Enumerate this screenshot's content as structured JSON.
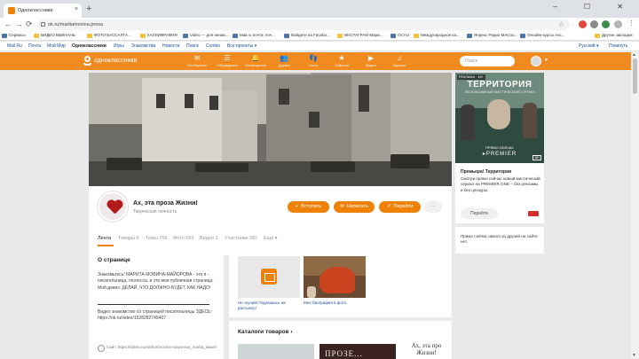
{
  "browser": {
    "tab_title": "Одноклассники",
    "tab_close": "×",
    "new_tab": "+",
    "window_buttons": "– ☐ ✕",
    "nav_back": "←",
    "nav_forward": "→",
    "nav_reload": "⟳",
    "url": "ok.ru/maritamovina.prosa",
    "star": "☆"
  },
  "bookmarks": [
    {
      "label": "Сервисы"
    },
    {
      "label": "ВИДЕО ВВИНАНЬ"
    },
    {
      "label": "ФОТО БАССАЛТА..."
    },
    {
      "label": "КАЛЛИФРАФИЯ"
    },
    {
      "label": "Video — для ненав..."
    },
    {
      "label": "Mail.ru почта: поч..."
    },
    {
      "label": "Войдите на Facebo..."
    },
    {
      "label": "ИНСТАГРАМ Мари..."
    },
    {
      "label": "OCAU"
    },
    {
      "label": "Международное ка..."
    },
    {
      "label": "Яндекс Радио МАСоо..."
    },
    {
      "label": "Онлайн-курсы Анс..."
    },
    {
      "label": "Другие закладки"
    }
  ],
  "mailru": {
    "items": [
      "Mail.Ru",
      "Почта",
      "Мой Мир",
      "Одноклассники",
      "Игры",
      "Знакомства",
      "Новости",
      "Поиск",
      "Combo",
      "Все проекты ▾"
    ],
    "language": "Русский ▾",
    "logout": "Покинуть"
  },
  "ok": {
    "brand": "одноклассники",
    "nav": [
      {
        "icon": "✉",
        "label": "Сообщения"
      },
      {
        "icon": "☰",
        "label": "Обсуждения"
      },
      {
        "icon": "🔔",
        "label": "Оповещения"
      },
      {
        "icon": "👥",
        "label": "Друзья"
      },
      {
        "icon": "👣",
        "label": "Гости"
      },
      {
        "icon": "★",
        "label": "События"
      },
      {
        "icon": "▶",
        "label": "Видео"
      },
      {
        "icon": "♫",
        "label": "Музыка"
      }
    ],
    "search_placeholder": "Поиск"
  },
  "profile": {
    "name": "Ах, эта проза Жизни!",
    "type": "Творческая личность",
    "join_button": "Вступить",
    "write_button": "Написать",
    "goto_button": "Перейти",
    "more_button": "···",
    "tabs": [
      "Лента",
      "Товары 6",
      "Темы 766",
      "Фото 693",
      "Видео 1",
      "Участники 382",
      "Ещё ▾"
    ]
  },
  "about": {
    "title": "О странице",
    "text1": "Знакомьтесь! МАРИТА МОВИНА-МАЙОРОВА - это я - писательница, поэтесса, и это моя публичная страница. Мой девиз: ДЕЛАЙ, ЧТО ДОЛЖНО-БУДЕТ, КАК НАДО!",
    "text2": "Видео знакомство со страницей писательницы ЗДЕСЬ: https://ok.ru/video/1528282745407",
    "site": "Сайт: https://ridero.ru/author/movina-mayorova_marita_iaaue/"
  },
  "media": {
    "items": [
      {
        "caption": "Не скучай! Подпишись на рассылку!"
      },
      {
        "caption": "Моя биография в фото"
      }
    ]
  },
  "catalog": {
    "title": "Каталоги товаров",
    "arrow": "›",
    "item2_text": "ПРОЗЕ...",
    "item3_text": "Ах, эта про Жизни!"
  },
  "ad": {
    "label": "РЕКЛАМА · 18+",
    "title": "ТЕРРИТОРИЯ",
    "subtitle": "ЭКСКЛЮЗИВНЫЙ МИСТИЧЕСКИЙ СЕРИАЛ",
    "now": "ПРЯМО СЕЙЧАС",
    "brand": "▸PREMIER",
    "rating": "18+",
    "heading": "Премьера! Территория",
    "text": "Смотри прямо сейчас новый мистический сериал на PREMIER.ONE – без рекламы и без цензуры.",
    "button": "Перейти",
    "bottom_text": "Прямо сейчас никого из друзей на сайте нет."
  },
  "colors": {
    "ok_orange": "#ee8208",
    "header_orange": "#f28b1f",
    "link_blue": "#1a4f9b"
  }
}
